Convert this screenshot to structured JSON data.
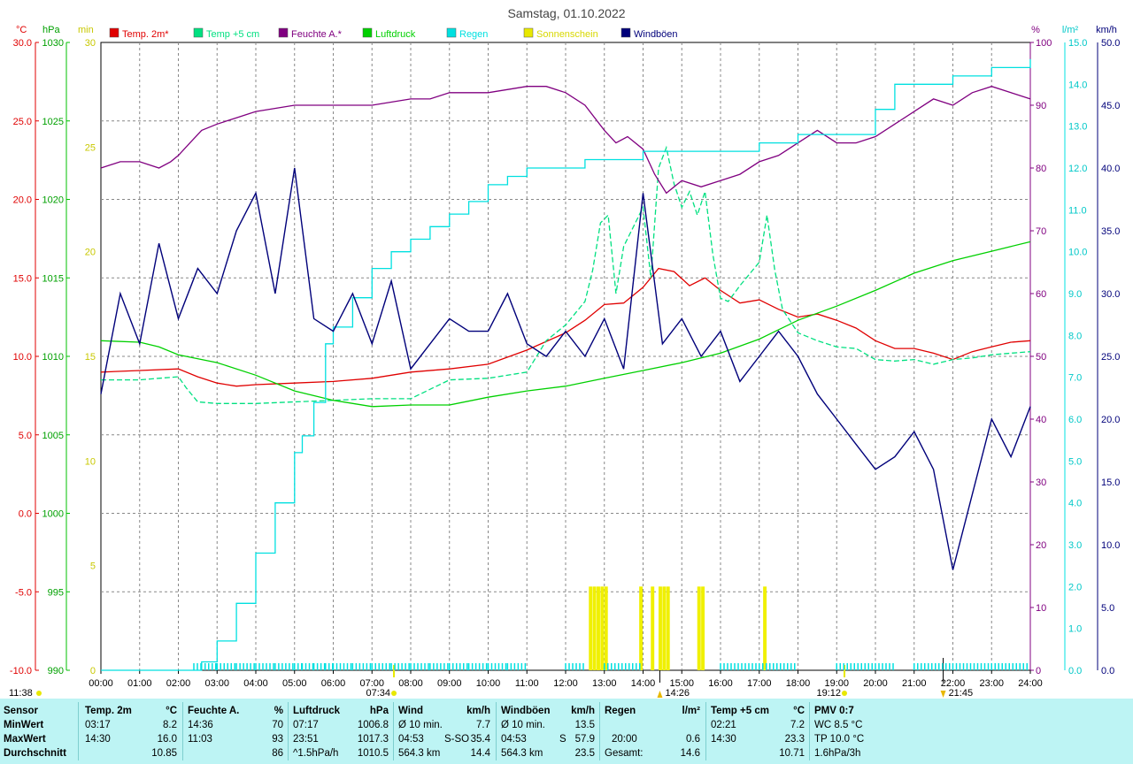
{
  "title": "Samstag, 01.10.2022",
  "units": {
    "temp": "°C",
    "pressure": "hPa",
    "sun": "min",
    "humidity": "%",
    "rain": "l/m²",
    "wind": "km/h"
  },
  "legend": [
    {
      "label": "Temp. 2m*",
      "color": "#e00000"
    },
    {
      "label": "Temp +5 cm",
      "color": "#00e080"
    },
    {
      "label": "Feuchte A.*",
      "color": "#800080"
    },
    {
      "label": "Luftdruck",
      "color": "#00d000"
    },
    {
      "label": "Regen",
      "color": "#00e0e0"
    },
    {
      "label": "Sonnenschein",
      "color": "#e8e800"
    },
    {
      "label": "Windböen",
      "color": "#00007a"
    }
  ],
  "axes": {
    "temp_ticks": [
      "30.0",
      "25.0",
      "20.0",
      "15.0",
      "10.0",
      "5.0",
      "0.0",
      "-5.0",
      "-10.0"
    ],
    "pressure_ticks": [
      "1030",
      "1025",
      "1020",
      "1015",
      "1010",
      "1005",
      "1000",
      "995",
      "990"
    ],
    "sun_ticks": [
      "30",
      "25",
      "20",
      "15",
      "10",
      "5",
      "0"
    ],
    "humidity_ticks": [
      "100",
      "90",
      "80",
      "70",
      "60",
      "50",
      "40",
      "30",
      "20",
      "10",
      "0"
    ],
    "rain_ticks": [
      "15.0",
      "14.0",
      "13.0",
      "12.0",
      "11.0",
      "10.0",
      "9.0",
      "8.0",
      "7.0",
      "6.0",
      "5.0",
      "4.0",
      "3.0",
      "2.0",
      "1.0",
      "0.0"
    ],
    "wind_ticks": [
      "50.0",
      "45.0",
      "40.0",
      "35.0",
      "30.0",
      "25.0",
      "20.0",
      "15.0",
      "10.0",
      "5.0",
      "0.0"
    ],
    "time_ticks": [
      "00:00",
      "01:00",
      "02:00",
      "03:00",
      "04:00",
      "05:00",
      "06:00",
      "07:00",
      "08:00",
      "09:00",
      "10:00",
      "11:00",
      "12:00",
      "13:00",
      "14:00",
      "15:00",
      "16:00",
      "17:00",
      "18:00",
      "19:00",
      "20:00",
      "21:00",
      "22:00",
      "23:00",
      "24:00"
    ],
    "markers": {
      "daylength": "11:38",
      "sunrise": "07:34",
      "sunset": "19:12",
      "max_temp_time": "14:26",
      "min_temp_time": "21:45"
    }
  },
  "chart_data": {
    "type": "line",
    "xlabel": "",
    "ylabel": "",
    "x_range": [
      "00:00",
      "24:00"
    ],
    "temp_range": [
      -10,
      30
    ],
    "pressure_range": [
      990,
      1030
    ],
    "humidity_range": [
      0,
      100
    ],
    "rain_range": [
      0,
      15
    ],
    "wind_range": [
      0,
      50
    ],
    "sun_range": [
      0,
      30
    ],
    "grid": true,
    "legend_position": "top",
    "series": [
      {
        "name": "Temp. 2m*",
        "axis": "temp",
        "x": [
          0,
          1,
          2,
          2.5,
          3,
          3.5,
          4,
          5,
          6,
          7,
          8,
          9,
          10,
          11,
          12,
          12.5,
          13,
          13.5,
          14,
          14.4,
          14.8,
          15.2,
          15.6,
          16,
          16.5,
          17,
          17.5,
          18,
          18.5,
          19,
          19.5,
          20,
          20.5,
          21,
          21.5,
          22,
          22.5,
          23,
          23.5,
          24
        ],
        "values": [
          9.0,
          9.1,
          9.2,
          8.7,
          8.3,
          8.1,
          8.2,
          8.3,
          8.4,
          8.6,
          9.0,
          9.2,
          9.5,
          10.4,
          11.5,
          12.3,
          13.3,
          13.4,
          14.4,
          15.6,
          15.4,
          14.5,
          15.0,
          14.2,
          13.4,
          13.6,
          13.0,
          12.5,
          12.7,
          12.3,
          11.8,
          11.0,
          10.5,
          10.5,
          10.2,
          9.8,
          10.3,
          10.6,
          10.9,
          11.0
        ]
      },
      {
        "name": "Temp +5 cm",
        "axis": "temp",
        "x": [
          0,
          1,
          1.5,
          2,
          2.2,
          2.5,
          3,
          4,
          5,
          6,
          7,
          8,
          9,
          10,
          11,
          11.5,
          12,
          12.5,
          12.7,
          12.9,
          13.1,
          13.3,
          13.5,
          14,
          14.2,
          14.4,
          14.6,
          14.8,
          15,
          15.2,
          15.4,
          15.6,
          15.8,
          16,
          16.2,
          16.5,
          17,
          17.2,
          17.4,
          17.6,
          18,
          18.5,
          19,
          19.5,
          20,
          20.5,
          21,
          21.5,
          22,
          22.5,
          23,
          23.5,
          24
        ],
        "values": [
          8.5,
          8.5,
          8.6,
          8.7,
          8.0,
          7.1,
          7.0,
          7.0,
          7.1,
          7.2,
          7.3,
          7.3,
          8.5,
          8.6,
          9.0,
          11.0,
          12.0,
          13.5,
          15.5,
          18.5,
          19.0,
          14.0,
          17.0,
          19.5,
          15.0,
          22.0,
          23.3,
          21.0,
          19.5,
          20.5,
          19.0,
          20.5,
          16.5,
          13.7,
          13.5,
          14.5,
          16.0,
          19.0,
          15.5,
          13.0,
          11.5,
          11.0,
          10.6,
          10.5,
          9.8,
          9.7,
          9.8,
          9.5,
          9.8,
          9.9,
          10.1,
          10.2,
          10.3
        ]
      },
      {
        "name": "Feuchte A.*",
        "axis": "humidity",
        "x": [
          0,
          0.5,
          1,
          1.5,
          1.8,
          2,
          2.3,
          2.6,
          3,
          3.5,
          4,
          5,
          6,
          7,
          8,
          8.5,
          9,
          10,
          11,
          11.5,
          12,
          12.5,
          13,
          13.3,
          13.6,
          14,
          14.3,
          14.6,
          15,
          15.5,
          16,
          16.5,
          17,
          17.5,
          18,
          18.5,
          19,
          19.5,
          20,
          20.5,
          21,
          21.5,
          22,
          22.5,
          23,
          23.5,
          24
        ],
        "values": [
          80,
          81,
          81,
          80,
          81,
          82,
          84,
          86,
          87,
          88,
          89,
          90,
          90,
          90,
          91,
          91,
          92,
          92,
          93,
          93,
          92,
          90,
          86,
          84,
          85,
          83,
          79,
          76,
          78,
          77,
          78,
          79,
          81,
          82,
          84,
          86,
          84,
          84,
          85,
          87,
          89,
          91,
          90,
          92,
          93,
          92,
          91
        ]
      },
      {
        "name": "Luftdruck",
        "axis": "pressure",
        "x": [
          0,
          1,
          1.5,
          2,
          3,
          4,
          5,
          6,
          7,
          8,
          9,
          10,
          11,
          12,
          13,
          14,
          15,
          16,
          17,
          18,
          19,
          20,
          21,
          22,
          23,
          23.5,
          24
        ],
        "values": [
          1011.0,
          1010.9,
          1010.6,
          1010.1,
          1009.6,
          1008.8,
          1007.8,
          1007.2,
          1006.8,
          1006.9,
          1006.9,
          1007.4,
          1007.8,
          1008.1,
          1008.6,
          1009.1,
          1009.6,
          1010.2,
          1011.1,
          1012.3,
          1013.2,
          1014.2,
          1015.3,
          1016.1,
          1016.7,
          1017.0,
          1017.3
        ]
      },
      {
        "name": "Regen",
        "axis": "rain",
        "x": [
          0,
          2.4,
          2.6,
          3,
          3.5,
          4,
          4.5,
          5,
          5.2,
          5.5,
          5.8,
          6,
          6.5,
          7,
          7.5,
          8,
          8.5,
          9,
          9.5,
          10,
          10.5,
          11,
          12,
          12.5,
          13,
          14,
          15,
          16,
          17,
          18,
          19,
          20,
          20.5,
          21,
          22,
          23,
          24
        ],
        "values": [
          0,
          0,
          0.2,
          0.7,
          1.6,
          2.8,
          4.0,
          5.2,
          5.6,
          6.4,
          7.8,
          8.2,
          8.9,
          9.6,
          10.0,
          10.3,
          10.6,
          10.9,
          11.2,
          11.6,
          11.8,
          12.0,
          12.0,
          12.2,
          12.2,
          12.4,
          12.4,
          12.4,
          12.6,
          12.8,
          12.8,
          13.4,
          14.0,
          14.0,
          14.2,
          14.4,
          14.6
        ]
      },
      {
        "name": "Windböen",
        "axis": "wind",
        "x": [
          0,
          0.5,
          1,
          1.5,
          2,
          2.5,
          3,
          3.5,
          4,
          4.5,
          5,
          5.5,
          6,
          6.5,
          7,
          7.5,
          8,
          8.5,
          9,
          9.5,
          10,
          10.5,
          11,
          11.5,
          12,
          12.5,
          13,
          13.5,
          14,
          14.5,
          15,
          15.5,
          16,
          16.5,
          17,
          17.5,
          18,
          18.5,
          19,
          19.5,
          20,
          20.5,
          21,
          21.5,
          22,
          22.5,
          23,
          23.5,
          24
        ],
        "values": [
          22,
          30,
          26,
          34,
          28,
          32,
          30,
          35,
          38,
          30,
          40,
          28,
          27,
          30,
          26,
          31,
          24,
          26,
          28,
          27,
          27,
          30,
          26,
          25,
          27,
          25,
          28,
          24,
          38,
          26,
          28,
          25,
          27,
          23,
          25,
          27,
          25,
          22,
          20,
          18,
          16,
          17,
          19,
          16,
          8,
          14,
          20,
          17,
          21
        ]
      }
    ],
    "sunshine": {
      "name": "Sonnenschein",
      "axis": "sun",
      "x": [
        12.6,
        12.7,
        12.8,
        12.9,
        13.0,
        13.9,
        14.2,
        14.4,
        14.5,
        14.6,
        15.4,
        15.5,
        17.1
      ],
      "values": [
        4,
        4,
        4,
        4,
        4,
        4,
        4,
        4,
        4,
        4,
        4,
        4,
        4
      ]
    }
  },
  "stats": {
    "sensor": {
      "h": "Sensor",
      "rows": [
        "MinWert",
        "MaxWert",
        "Durchschnitt"
      ]
    },
    "temp": {
      "h": "Temp. 2m",
      "u": "°C",
      "r1t": "03:17",
      "r1v": "8.2",
      "r2t": "14:30",
      "r2v": "16.0",
      "r3t": "",
      "r3v": "10.85"
    },
    "hum": {
      "h": "Feuchte A.",
      "u": "%",
      "r1t": "14:36",
      "r1v": "70",
      "r2t": "11:03",
      "r2v": "93",
      "r3t": "",
      "r3v": "86"
    },
    "press": {
      "h": "Luftdruck",
      "u": "hPa",
      "r1t": "07:17",
      "r1v": "1006.8",
      "r2t": "23:51",
      "r2v": "1017.3",
      "r3t": "^1.5hPa/h",
      "r3v": "1010.5"
    },
    "wind": {
      "h": "Wind",
      "u": "km/h",
      "r1t": "Ø 10 min.",
      "r1v": "7.7",
      "r2t": "04:53",
      "r2m": "S-SO",
      "r2v": "35.4",
      "r3t": "564.3 km",
      "r3v": "14.4"
    },
    "gust": {
      "h": "Windböen",
      "u": "km/h",
      "r1t": "Ø 10 min.",
      "r1v": "13.5",
      "r2t": "04:53",
      "r2m": "S",
      "r2v": "57.9",
      "r3t": "564.3 km",
      "r3v": "23.5"
    },
    "rain": {
      "h": "Regen",
      "u": "l/m²",
      "r1t": "",
      "r1v": "",
      "r2t": "20:00",
      "r2v": "0.6",
      "r3t": "Gesamt:",
      "r3v": "14.6"
    },
    "temp5": {
      "h": "Temp +5 cm",
      "u": "°C",
      "r1t": "02:21",
      "r1v": "7.2",
      "r2t": "14:30",
      "r2v": "23.3",
      "r3t": "",
      "r3v": "10.71"
    },
    "pmv": {
      "h": "PMV 0:7",
      "r1": "WC 8.5 °C",
      "r2": "TP 10.0 °C",
      "r3": "1.6hPa/3h"
    }
  }
}
